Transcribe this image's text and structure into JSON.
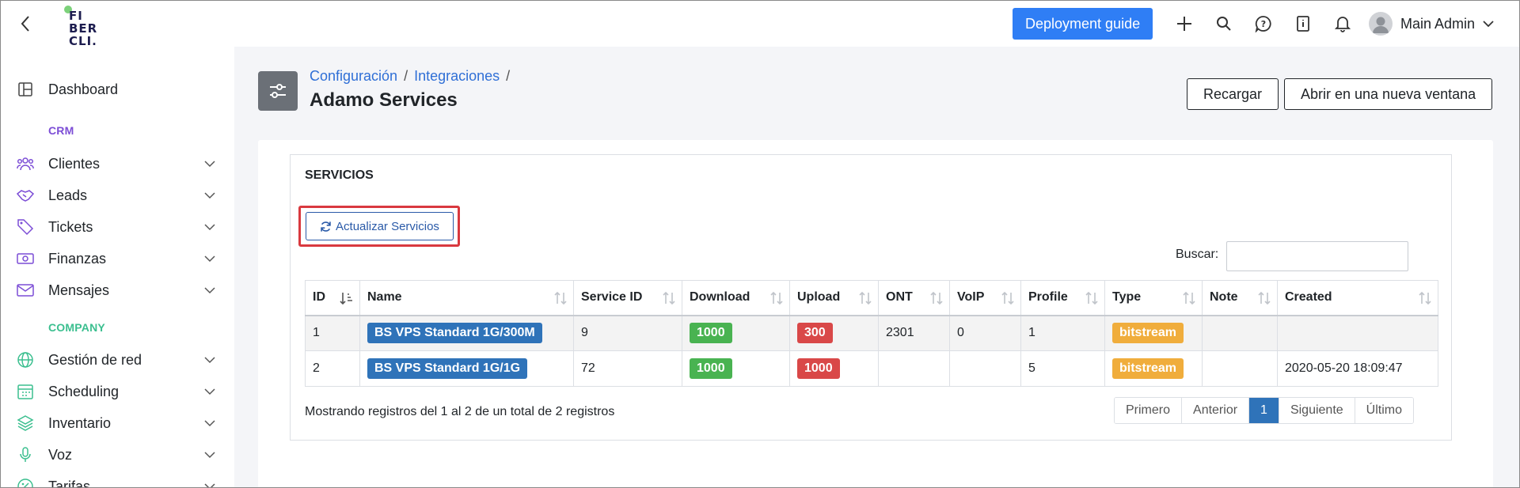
{
  "logo": {
    "text_line1": "FI",
    "text_line2": "BER",
    "text_line3": "CLI."
  },
  "topbar": {
    "deploy_label": "Deployment guide",
    "user_name": "Main Admin"
  },
  "sidebar": {
    "items": [
      {
        "label": "Dashboard",
        "icon": "layout-icon"
      },
      {
        "label": "Clientes",
        "icon": "users-icon"
      },
      {
        "label": "Leads",
        "icon": "handshake-icon"
      },
      {
        "label": "Tickets",
        "icon": "ticket-icon"
      },
      {
        "label": "Finanzas",
        "icon": "money-icon"
      },
      {
        "label": "Mensajes",
        "icon": "mail-icon"
      },
      {
        "label": "Gestión de red",
        "icon": "globe-icon"
      },
      {
        "label": "Scheduling",
        "icon": "calendar-icon"
      },
      {
        "label": "Inventario",
        "icon": "layers-icon"
      },
      {
        "label": "Voz",
        "icon": "mic-icon"
      },
      {
        "label": "Tarifas",
        "icon": "percent-icon"
      }
    ],
    "sections": {
      "crm": "CRM",
      "company": "COMPANY"
    },
    "colors": {
      "crm": "#7c4dd6",
      "company": "#3bbf8f"
    }
  },
  "breadcrumb": {
    "item1": "Configuración",
    "item2": "Integraciones",
    "sep": "/"
  },
  "page": {
    "title": "Adamo Services",
    "reload_label": "Recargar",
    "open_new_label": "Abrir en una nueva ventana"
  },
  "panel": {
    "title": "SERVICIOS",
    "update_label": "Actualizar Servicios",
    "search_label": "Buscar:"
  },
  "table": {
    "columns": [
      "ID",
      "Name",
      "Service ID",
      "Download",
      "Upload",
      "ONT",
      "VoIP",
      "Profile",
      "Type",
      "Note",
      "Created"
    ],
    "rows": [
      {
        "id": "1",
        "name": "BS VPS Standard 1G/300M",
        "service_id": "9",
        "download": "1000",
        "upload": "300",
        "ont": "2301",
        "voip": "0",
        "profile": "1",
        "type": "bitstream",
        "note": "",
        "created": ""
      },
      {
        "id": "2",
        "name": "BS VPS Standard 1G/1G",
        "service_id": "72",
        "download": "1000",
        "upload": "1000",
        "ont": "",
        "voip": "",
        "profile": "5",
        "type": "bitstream",
        "note": "",
        "created": "2020-05-20 18:09:47"
      }
    ]
  },
  "footer": {
    "info": "Mostrando registros del 1 al 2 de un total de 2 registros",
    "pager": {
      "first": "Primero",
      "prev": "Anterior",
      "current": "1",
      "next": "Siguiente",
      "last": "Último"
    }
  },
  "colors": {
    "accent": "#2f7ef5",
    "highlight": "#d9393f",
    "badge_blue": "#2f73b9",
    "badge_green": "#49b351",
    "badge_red": "#d94848",
    "badge_orange": "#f0ad3c"
  }
}
